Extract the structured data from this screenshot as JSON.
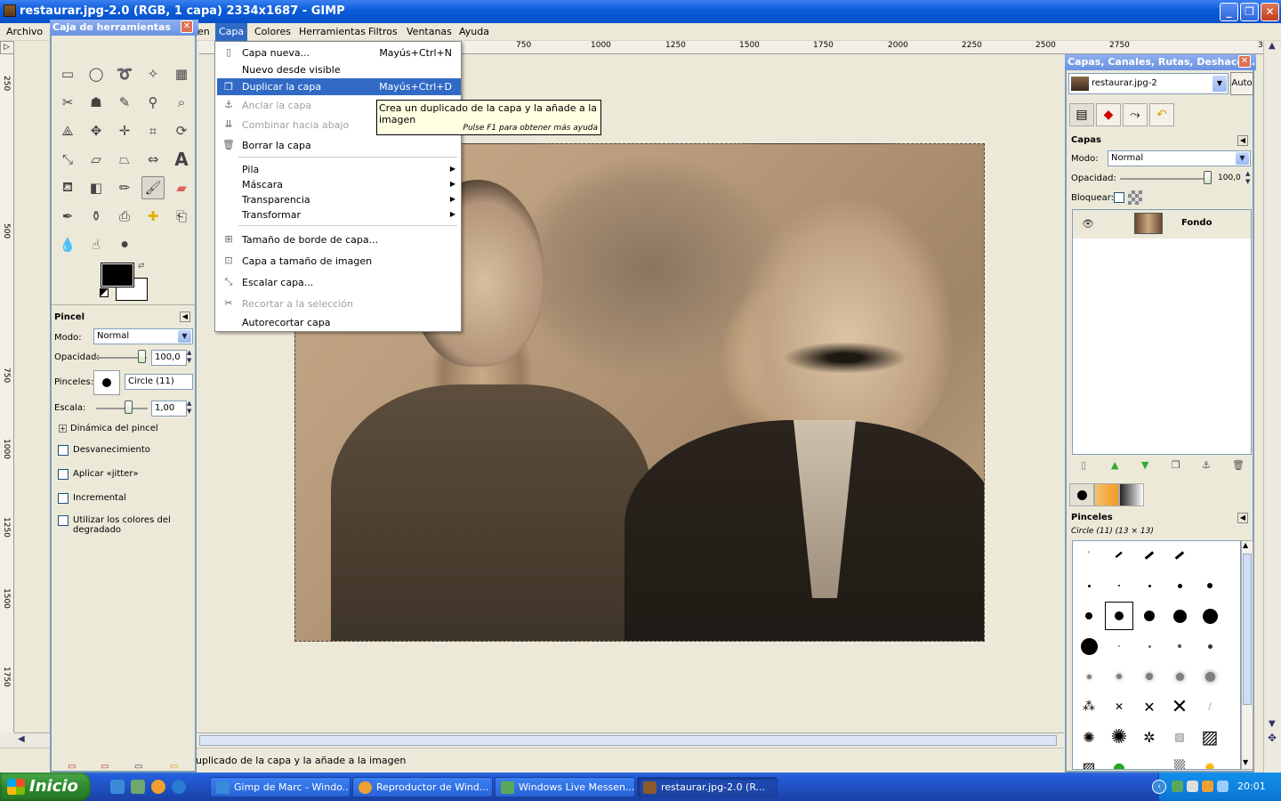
{
  "window": {
    "title": "restaurar.jpg-2.0 (RGB, 1 capa) 2334x1687 - GIMP",
    "minimize": "_",
    "maximize": "❐",
    "close": "✕"
  },
  "menubar": {
    "items": [
      "Archivo",
      "en",
      "Capa",
      "Colores",
      "Herramientas",
      "Filtros",
      "Ventanas",
      "Ayuda"
    ],
    "active": "Capa"
  },
  "ruler": {
    "h_ticks": [
      "750",
      "1000",
      "1250",
      "1500",
      "1750",
      "2000",
      "2250",
      "2500",
      "2750",
      "3"
    ],
    "v_ticks": [
      "250",
      "500",
      "750",
      "1000",
      "1250",
      "1500",
      "1750"
    ]
  },
  "layer_menu": {
    "items": [
      {
        "label": "Capa nueva...",
        "shortcut": "Mayús+Ctrl+N",
        "state": "normal",
        "icon": "new-layer-icon"
      },
      {
        "label": "Nuevo desde visible",
        "shortcut": "",
        "state": "normal",
        "icon": ""
      },
      {
        "label": "Duplicar la capa",
        "shortcut": "Mayús+Ctrl+D",
        "state": "highlighted",
        "icon": "duplicate-icon"
      },
      {
        "label": "Anclar la capa",
        "shortcut": "",
        "state": "disabled",
        "icon": "anchor-icon"
      },
      {
        "label": "Combinar hacia abajo",
        "shortcut": "",
        "state": "disabled",
        "icon": "merge-icon"
      },
      {
        "label": "Borrar la capa",
        "shortcut": "",
        "state": "normal",
        "icon": "trash-icon"
      },
      {
        "label": "Pila",
        "submenu": true
      },
      {
        "label": "Máscara",
        "submenu": true
      },
      {
        "label": "Transparencia",
        "submenu": true
      },
      {
        "label": "Transformar",
        "submenu": true
      },
      {
        "label": "Tamaño de borde de capa...",
        "icon": "resize-icon"
      },
      {
        "label": "Capa a tamaño de imagen",
        "icon": "fit-icon"
      },
      {
        "label": "Escalar capa...",
        "icon": "scale-icon"
      },
      {
        "label": "Recortar a la selección",
        "state": "disabled",
        "icon": "crop-icon"
      },
      {
        "label": "Autorecortar capa",
        "icon": ""
      }
    ]
  },
  "tooltip": {
    "text": "Crea un duplicado de la capa y la añade a la imagen",
    "help": "Pulse F1 para obtener más ayuda"
  },
  "status": {
    "text": "uplicado de la capa y la añade a la imagen"
  },
  "toolbox": {
    "title": "Caja de herramientas",
    "tool_options": {
      "title": "Pincel",
      "mode_label": "Modo:",
      "mode_value": "Normal",
      "opacity_label": "Opacidad:",
      "opacity_value": "100,0",
      "brush_label": "Pinceles:",
      "brush_value": "Circle (11)",
      "scale_label": "Escala:",
      "scale_value": "1,00",
      "dynamics_label": "Dinámica del pincel",
      "fade_label": "Desvanecimiento",
      "jitter_label": "Aplicar «jitter»",
      "incremental_label": "Incremental",
      "gradient_label": "Utilizar los colores del degradado"
    }
  },
  "dock": {
    "title": "Capas, Canales, Rutas, Deshacer ...",
    "image_selector": "restaurar.jpg-2",
    "auto_button": "Auto",
    "layers": {
      "title": "Capas",
      "mode_label": "Modo:",
      "mode_value": "Normal",
      "opacity_label": "Opacidad:",
      "opacity_value": "100,0",
      "lock_label": "Bloquear:",
      "layer_name": "Fondo"
    },
    "brushes": {
      "title": "Pinceles",
      "current": "Circle (11) (13 × 13)"
    }
  },
  "taskbar": {
    "start": "Inicio",
    "tasks": [
      {
        "label": "Gimp de Marc - Windo...",
        "active": false
      },
      {
        "label": "Reproductor de Wind...",
        "active": false
      },
      {
        "label": "Windows Live Messen...",
        "active": false
      },
      {
        "label": "restaurar.jpg-2.0 (R...",
        "active": true
      }
    ],
    "clock": "20:01"
  },
  "colors": {
    "accent": "#316ac5",
    "titlebar": "#0a5bd8",
    "taskbar": "#245edb",
    "start_green": "#2f8a2f"
  }
}
